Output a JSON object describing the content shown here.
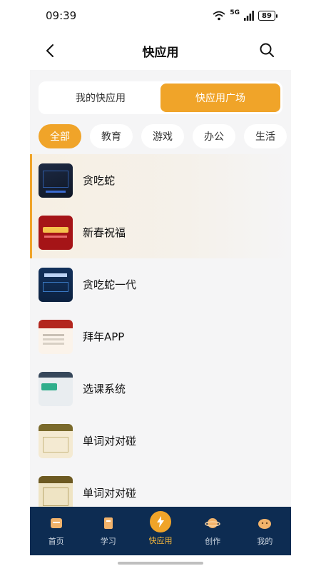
{
  "status_bar": {
    "time": "09:39",
    "network": "5G",
    "battery": "89"
  },
  "header": {
    "title": "快应用",
    "back_icon": "back-icon",
    "search_icon": "search-icon"
  },
  "segments": [
    {
      "label": "我的快应用",
      "active": false
    },
    {
      "label": "快应用广场",
      "active": true
    }
  ],
  "categories": [
    "全部",
    "教育",
    "游戏",
    "办公",
    "生活"
  ],
  "apps": [
    {
      "name": "贪吃蛇"
    },
    {
      "name": "新春祝福"
    },
    {
      "name": "贪吃蛇一代"
    },
    {
      "name": "拜年APP"
    },
    {
      "name": "选课系统"
    },
    {
      "name": "单词对对碰"
    },
    {
      "name": "单词对对碰"
    }
  ],
  "tabbar": [
    {
      "label": "首页",
      "icon": "home-icon",
      "active": false
    },
    {
      "label": "学习",
      "icon": "book-icon",
      "active": false
    },
    {
      "label": "快应用",
      "icon": "lightning-icon",
      "active": true
    },
    {
      "label": "创作",
      "icon": "planet-icon",
      "active": false
    },
    {
      "label": "我的",
      "icon": "profile-icon",
      "active": false
    }
  ],
  "colors": {
    "accent": "#f0a429",
    "tabbar_bg": "#0d2c52",
    "page_bg": "#f5f5f6"
  }
}
